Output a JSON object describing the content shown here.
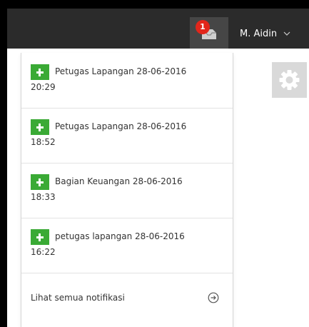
{
  "header": {
    "notification_count": "1",
    "user_name": "M. Aidin"
  },
  "notifications": [
    {
      "line1": "Petugas Lapangan 28-06-2016",
      "line2": "20:29"
    },
    {
      "line1": "Petugas Lapangan 28-06-2016",
      "line2": "18:52"
    },
    {
      "line1": "Bagian Keuangan 28-06-2016",
      "line2": "18:33"
    },
    {
      "line1": "petugas lapangan 28-06-2016",
      "line2": "16:22"
    }
  ],
  "footer": {
    "see_all_label": "Lihat semua notifikasi"
  },
  "colors": {
    "topbar": "#2b2b2b",
    "badge": "#e2261b",
    "plus_icon": "#3aaa35"
  },
  "icons": {
    "notification": "tray-icon",
    "user_menu": "chevron-down-icon",
    "settings": "gear-icon",
    "notification_item": "plus-icon",
    "see_all": "arrow-right-circle-icon"
  }
}
